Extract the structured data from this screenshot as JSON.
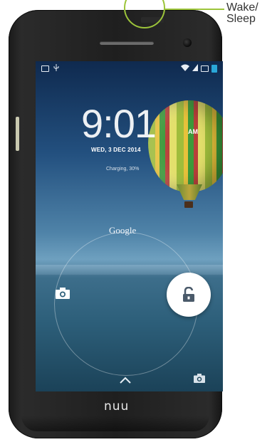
{
  "callout": {
    "label_line1": "Wake/",
    "label_line2": "Sleep",
    "color": "#9cc43a"
  },
  "phone": {
    "brand": "nuu"
  },
  "status_bar": {
    "left_icons": [
      "image-icon",
      "usb-icon"
    ],
    "right_icons": [
      "wifi-icon",
      "signal-icon",
      "sim-icon",
      "battery-icon"
    ]
  },
  "lock_screen": {
    "time": "9:01",
    "ampm": "AM",
    "date": "WED, 3 DEC 2014",
    "charging": "Charging, 30%",
    "search_label": "Google"
  },
  "actions": {
    "left": "camera-icon",
    "center": "unlock-icon",
    "bottom_center": "chevron-up-icon",
    "bottom_right": "camera-icon"
  }
}
